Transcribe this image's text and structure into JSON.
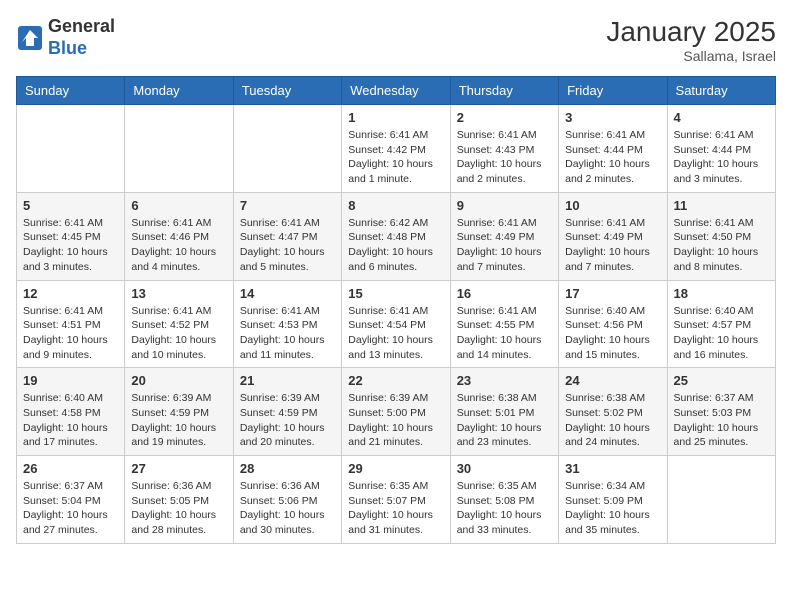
{
  "header": {
    "logo_general": "General",
    "logo_blue": "Blue",
    "month_year": "January 2025",
    "location": "Sallama, Israel"
  },
  "weekdays": [
    "Sunday",
    "Monday",
    "Tuesday",
    "Wednesday",
    "Thursday",
    "Friday",
    "Saturday"
  ],
  "weeks": [
    [
      {
        "day": "",
        "sunrise": "",
        "sunset": "",
        "daylight": ""
      },
      {
        "day": "",
        "sunrise": "",
        "sunset": "",
        "daylight": ""
      },
      {
        "day": "",
        "sunrise": "",
        "sunset": "",
        "daylight": ""
      },
      {
        "day": "1",
        "sunrise": "Sunrise: 6:41 AM",
        "sunset": "Sunset: 4:42 PM",
        "daylight": "Daylight: 10 hours and 1 minute."
      },
      {
        "day": "2",
        "sunrise": "Sunrise: 6:41 AM",
        "sunset": "Sunset: 4:43 PM",
        "daylight": "Daylight: 10 hours and 2 minutes."
      },
      {
        "day": "3",
        "sunrise": "Sunrise: 6:41 AM",
        "sunset": "Sunset: 4:44 PM",
        "daylight": "Daylight: 10 hours and 2 minutes."
      },
      {
        "day": "4",
        "sunrise": "Sunrise: 6:41 AM",
        "sunset": "Sunset: 4:44 PM",
        "daylight": "Daylight: 10 hours and 3 minutes."
      }
    ],
    [
      {
        "day": "5",
        "sunrise": "Sunrise: 6:41 AM",
        "sunset": "Sunset: 4:45 PM",
        "daylight": "Daylight: 10 hours and 3 minutes."
      },
      {
        "day": "6",
        "sunrise": "Sunrise: 6:41 AM",
        "sunset": "Sunset: 4:46 PM",
        "daylight": "Daylight: 10 hours and 4 minutes."
      },
      {
        "day": "7",
        "sunrise": "Sunrise: 6:41 AM",
        "sunset": "Sunset: 4:47 PM",
        "daylight": "Daylight: 10 hours and 5 minutes."
      },
      {
        "day": "8",
        "sunrise": "Sunrise: 6:42 AM",
        "sunset": "Sunset: 4:48 PM",
        "daylight": "Daylight: 10 hours and 6 minutes."
      },
      {
        "day": "9",
        "sunrise": "Sunrise: 6:41 AM",
        "sunset": "Sunset: 4:49 PM",
        "daylight": "Daylight: 10 hours and 7 minutes."
      },
      {
        "day": "10",
        "sunrise": "Sunrise: 6:41 AM",
        "sunset": "Sunset: 4:49 PM",
        "daylight": "Daylight: 10 hours and 7 minutes."
      },
      {
        "day": "11",
        "sunrise": "Sunrise: 6:41 AM",
        "sunset": "Sunset: 4:50 PM",
        "daylight": "Daylight: 10 hours and 8 minutes."
      }
    ],
    [
      {
        "day": "12",
        "sunrise": "Sunrise: 6:41 AM",
        "sunset": "Sunset: 4:51 PM",
        "daylight": "Daylight: 10 hours and 9 minutes."
      },
      {
        "day": "13",
        "sunrise": "Sunrise: 6:41 AM",
        "sunset": "Sunset: 4:52 PM",
        "daylight": "Daylight: 10 hours and 10 minutes."
      },
      {
        "day": "14",
        "sunrise": "Sunrise: 6:41 AM",
        "sunset": "Sunset: 4:53 PM",
        "daylight": "Daylight: 10 hours and 11 minutes."
      },
      {
        "day": "15",
        "sunrise": "Sunrise: 6:41 AM",
        "sunset": "Sunset: 4:54 PM",
        "daylight": "Daylight: 10 hours and 13 minutes."
      },
      {
        "day": "16",
        "sunrise": "Sunrise: 6:41 AM",
        "sunset": "Sunset: 4:55 PM",
        "daylight": "Daylight: 10 hours and 14 minutes."
      },
      {
        "day": "17",
        "sunrise": "Sunrise: 6:40 AM",
        "sunset": "Sunset: 4:56 PM",
        "daylight": "Daylight: 10 hours and 15 minutes."
      },
      {
        "day": "18",
        "sunrise": "Sunrise: 6:40 AM",
        "sunset": "Sunset: 4:57 PM",
        "daylight": "Daylight: 10 hours and 16 minutes."
      }
    ],
    [
      {
        "day": "19",
        "sunrise": "Sunrise: 6:40 AM",
        "sunset": "Sunset: 4:58 PM",
        "daylight": "Daylight: 10 hours and 17 minutes."
      },
      {
        "day": "20",
        "sunrise": "Sunrise: 6:39 AM",
        "sunset": "Sunset: 4:59 PM",
        "daylight": "Daylight: 10 hours and 19 minutes."
      },
      {
        "day": "21",
        "sunrise": "Sunrise: 6:39 AM",
        "sunset": "Sunset: 4:59 PM",
        "daylight": "Daylight: 10 hours and 20 minutes."
      },
      {
        "day": "22",
        "sunrise": "Sunrise: 6:39 AM",
        "sunset": "Sunset: 5:00 PM",
        "daylight": "Daylight: 10 hours and 21 minutes."
      },
      {
        "day": "23",
        "sunrise": "Sunrise: 6:38 AM",
        "sunset": "Sunset: 5:01 PM",
        "daylight": "Daylight: 10 hours and 23 minutes."
      },
      {
        "day": "24",
        "sunrise": "Sunrise: 6:38 AM",
        "sunset": "Sunset: 5:02 PM",
        "daylight": "Daylight: 10 hours and 24 minutes."
      },
      {
        "day": "25",
        "sunrise": "Sunrise: 6:37 AM",
        "sunset": "Sunset: 5:03 PM",
        "daylight": "Daylight: 10 hours and 25 minutes."
      }
    ],
    [
      {
        "day": "26",
        "sunrise": "Sunrise: 6:37 AM",
        "sunset": "Sunset: 5:04 PM",
        "daylight": "Daylight: 10 hours and 27 minutes."
      },
      {
        "day": "27",
        "sunrise": "Sunrise: 6:36 AM",
        "sunset": "Sunset: 5:05 PM",
        "daylight": "Daylight: 10 hours and 28 minutes."
      },
      {
        "day": "28",
        "sunrise": "Sunrise: 6:36 AM",
        "sunset": "Sunset: 5:06 PM",
        "daylight": "Daylight: 10 hours and 30 minutes."
      },
      {
        "day": "29",
        "sunrise": "Sunrise: 6:35 AM",
        "sunset": "Sunset: 5:07 PM",
        "daylight": "Daylight: 10 hours and 31 minutes."
      },
      {
        "day": "30",
        "sunrise": "Sunrise: 6:35 AM",
        "sunset": "Sunset: 5:08 PM",
        "daylight": "Daylight: 10 hours and 33 minutes."
      },
      {
        "day": "31",
        "sunrise": "Sunrise: 6:34 AM",
        "sunset": "Sunset: 5:09 PM",
        "daylight": "Daylight: 10 hours and 35 minutes."
      },
      {
        "day": "",
        "sunrise": "",
        "sunset": "",
        "daylight": ""
      }
    ]
  ]
}
